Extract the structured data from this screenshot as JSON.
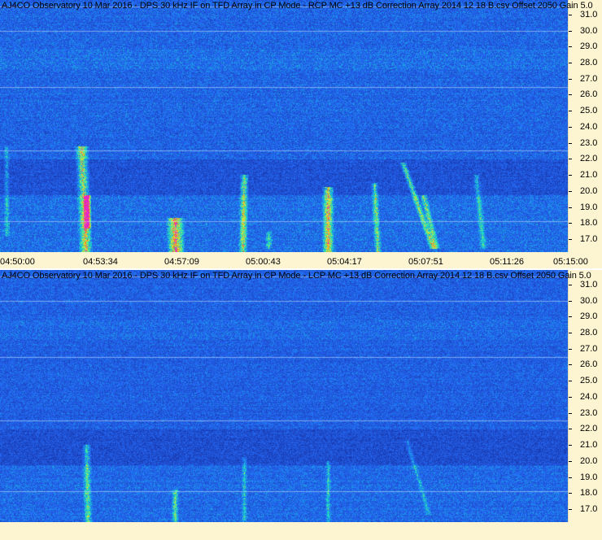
{
  "panels": [
    {
      "title": "AJ4CO Observatory 10 Mar 2016 - DPS 30 kHz IF on TFD Array in CP Mode - RCP  MC +13 dB  Correction Array 2014 12 18 B.csv  Offset 2050  Gain 5.0",
      "polarization": "RCP",
      "time_labels": [
        "04:50:00",
        "04:53:34",
        "04:57:09",
        "05:00:43",
        "05:04:17",
        "05:07:51",
        "05:11:26",
        "05:15:00"
      ]
    },
    {
      "title": "AJ4CO Observatory 10 Mar 2016 - DPS 30 kHz IF on TFD Array in CP Mode - LCP  MC +13 dB  Correction Array 2014 12 18 B.csv  Offset 2050  Gain 5.0",
      "polarization": "LCP",
      "time_labels": []
    }
  ],
  "freq_labels": [
    "31.0",
    "30.0",
    "29.0",
    "28.0",
    "27.0",
    "26.0",
    "25.0",
    "24.0",
    "23.0",
    "22.0",
    "21.0",
    "20.0",
    "19.0",
    "18.0",
    "17.0"
  ],
  "freq_range_mhz": [
    16.2,
    31.9
  ],
  "time_range": [
    "04:50:00",
    "05:15:00"
  ],
  "colors": {
    "background": "#fdf5d2",
    "spectrogram_base": "#1e4fd8"
  }
}
